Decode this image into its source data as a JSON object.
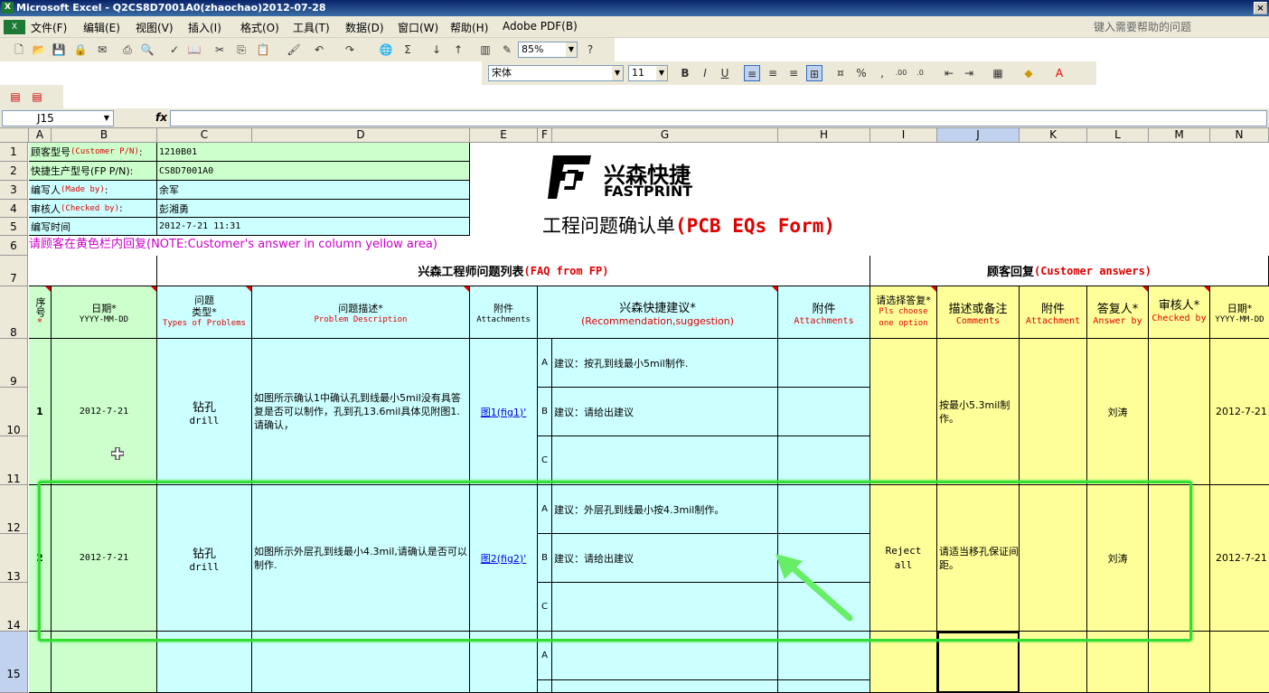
{
  "window": {
    "title": "Microsoft Excel - Q2CS8D7001A0(zhaochao)2012-07-28",
    "close": "×"
  },
  "menu": {
    "items": [
      "文件(F)",
      "编辑(E)",
      "视图(V)",
      "插入(I)",
      "格式(O)",
      "工具(T)",
      "数据(D)",
      "窗口(W)",
      "帮助(H)",
      "Adobe PDF(B)"
    ],
    "help_placeholder": "键入需要帮助的问题"
  },
  "toolbar": {
    "zoom": "85%",
    "font": "宋体",
    "size": "11",
    "bold": "B",
    "italic": "I",
    "underline": "U",
    "percent": "%",
    "comma": ","
  },
  "formula_bar": {
    "cell": "J15",
    "fx": "fx",
    "value": ""
  },
  "columns": [
    "A",
    "B",
    "C",
    "D",
    "E",
    "F",
    "G",
    "H",
    "I",
    "J",
    "K",
    "L",
    "M",
    "N"
  ],
  "rows": [
    "1",
    "2",
    "3",
    "4",
    "5",
    "6",
    "7",
    "8",
    "9",
    "10",
    "11",
    "12",
    "13",
    "14",
    "15"
  ],
  "header_info": [
    {
      "label": "顾客型号",
      "label_en": "(Customer P/N)",
      "sep": ":",
      "value": "1210B01"
    },
    {
      "label": "快捷生产型号(FP P/N):",
      "label_en": "",
      "sep": "",
      "value": "CS8D7001A0"
    },
    {
      "label": "编写人",
      "label_en": "(Made by)",
      "sep": ":",
      "value": "余军"
    },
    {
      "label": "审核人",
      "label_en": "(Checked by)",
      "sep": ":",
      "value": "彭湘勇"
    },
    {
      "label": "编写时间",
      "label_en": "",
      "sep": "",
      "value": "2012-7-21  11:31"
    }
  ],
  "logo": {
    "cn": "兴森快捷",
    "en": "FASTPRINT"
  },
  "form_title": {
    "cn": "工程问题确认单",
    "en": "(PCB EQs Form)"
  },
  "note": {
    "cn": "请顾客在黄色栏内回复",
    "en": "(NOTE:Customer's answer in column yellow area)"
  },
  "section": {
    "faq_cn": "兴森工程师问题列表",
    "faq_en": "(FAQ from FP)",
    "cust_cn": "顾客回复",
    "cust_en": "(Customer answers)"
  },
  "col_headers": {
    "seq": "序号",
    "date": "日期*",
    "date_fmt": "YYYY-MM-DD",
    "type1": "问题",
    "type2": "类型*",
    "type_en": "Types of Problems",
    "desc": "问题描述*",
    "desc_en": "Problem Description",
    "att": "附件",
    "att_en": "Attachments",
    "rec": "兴森快捷建议*",
    "rec_en": "(Recommendation,suggestion)",
    "att2": "附件",
    "att2_en": "Attachments",
    "choose": "请选择答复*",
    "choose_en": "Pls choose one option",
    "comments": "描述或备注",
    "comments_en": "Comments",
    "att3": "附件",
    "att3_en": "Attachment",
    "answer": "答复人*",
    "answer_en": "Answer by",
    "checked": "审核人*",
    "checked_en": "Checked by",
    "date2": "日期*",
    "date2_fmt": "YYYY-MM-DD"
  },
  "issues": [
    {
      "no": "1",
      "date": "2012-7-21",
      "type_cn": "钻孔",
      "type_en": "drill",
      "desc": "如图所示确认1中确认孔到线最小5mil没有具答复是否可以制作，孔到孔13.6mil具体见附图1.请确认，",
      "att": "图1(fig1)'",
      "opts": [
        {
          "k": "A",
          "v": "建议：按孔到线最小5mil制作."
        },
        {
          "k": "B",
          "v": "建议：请给出建议"
        },
        {
          "k": "C",
          "v": ""
        }
      ],
      "choice": "",
      "comment": "按最小5.3mil制作。",
      "answer_by": "刘涛",
      "date2": "2012-7-21"
    },
    {
      "no": "2",
      "date": "2012-7-21",
      "type_cn": "钻孔",
      "type_en": "drill",
      "desc": "如图所示外层孔到线最小4.3mil,请确认是否可以制作.",
      "att": "图2(fig2)'",
      "opts": [
        {
          "k": "A",
          "v": "建议：外层孔到线最小按4.3mil制作。"
        },
        {
          "k": "B",
          "v": "建议：请给出建议"
        },
        {
          "k": "C",
          "v": ""
        }
      ],
      "choice": "Reject all",
      "comment": "请适当移孔保证间距。",
      "answer_by": "刘涛",
      "date2": "2012-7-21"
    }
  ],
  "row15_opt": "A",
  "colors": {
    "green": "#ccffcc",
    "cyan": "#ccffff",
    "yellow": "#ffff99",
    "highlight": "#33dd33",
    "arrow": "#66ee66"
  }
}
